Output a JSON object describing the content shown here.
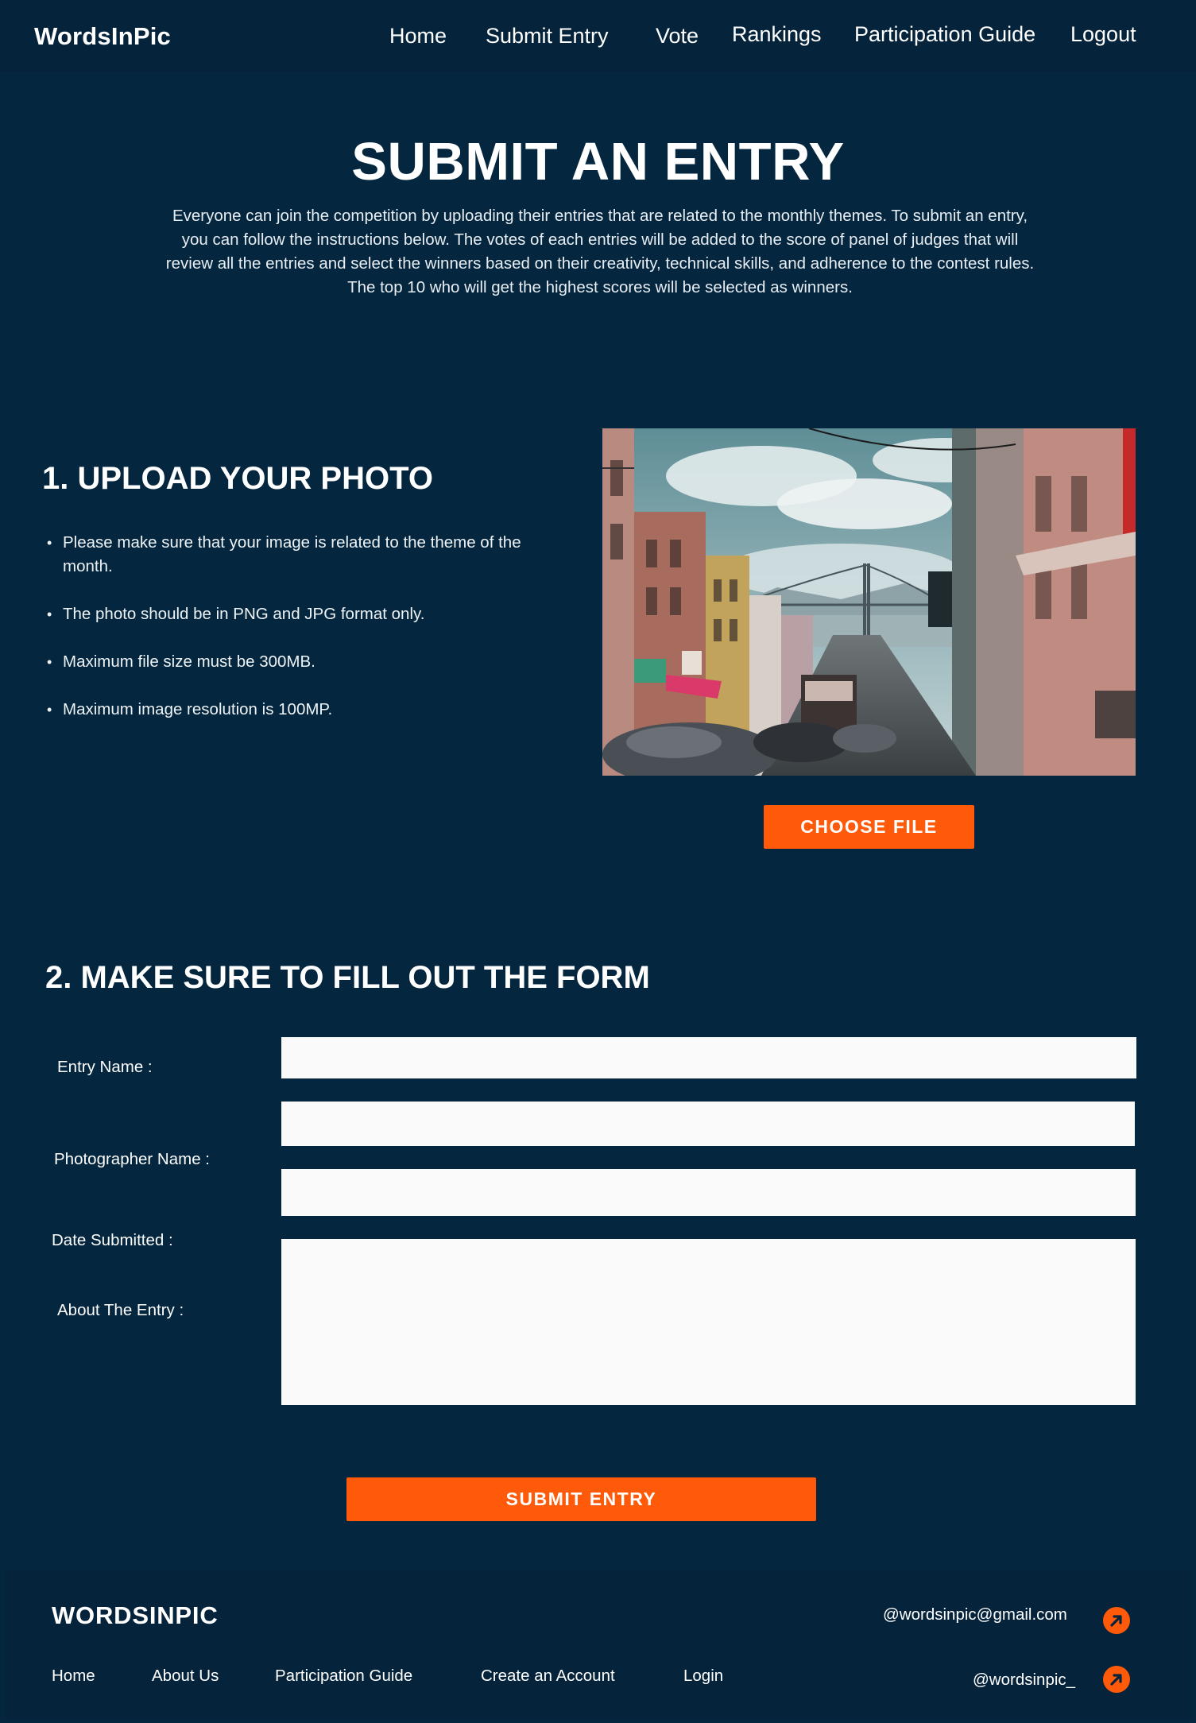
{
  "nav": {
    "brand": "WordsInPic",
    "links": [
      "Home",
      "Submit Entry",
      "Vote",
      "Rankings",
      "Participation Guide",
      "Logout"
    ]
  },
  "hero": {
    "title": "SUBMIT AN ENTRY",
    "description": "Everyone can join the competition by uploading their entries that are related to the monthly themes. To submit an entry, you can follow the instructions below. The votes of each entries will be added to the score of panel of judges that will review all the entries and select the winners based on their creativity, technical skills, and adherence to the contest rules. The top 10 who will get the highest scores will be selected as winners."
  },
  "upload": {
    "title": "1. UPLOAD YOUR PHOTO",
    "rules": [
      "Please make sure that your image is related to the theme of the month.",
      "The photo should be in PNG and JPG format only.",
      "Maximum file size must be 300MB.",
      "Maximum image resolution is 100MP."
    ],
    "choose_label": "CHOOSE FILE"
  },
  "form": {
    "title": "2. MAKE SURE TO FILL OUT THE FORM",
    "labels": {
      "entry_name": "Entry Name :",
      "photographer_name": "Photographer Name :",
      "date_submitted": "Date Submitted :",
      "about": "About The Entry :"
    },
    "values": {
      "entry_name": "",
      "photographer_name": "",
      "date_submitted": "",
      "about": ""
    },
    "submit_label": "SUBMIT ENTRY"
  },
  "footer": {
    "brand": "WORDSINPIC",
    "links": [
      "Home",
      "About Us",
      "Participation Guide",
      "Create an Account",
      "Login"
    ],
    "email": "@wordsinpic@gmail.com",
    "social": "@wordsinpic_"
  },
  "colors": {
    "background": "#04263e",
    "header_footer": "#05233a",
    "accent": "#ff5a0a",
    "field": "#fafafa"
  },
  "icons": {
    "link_badge": "arrow-up-right-icon"
  }
}
